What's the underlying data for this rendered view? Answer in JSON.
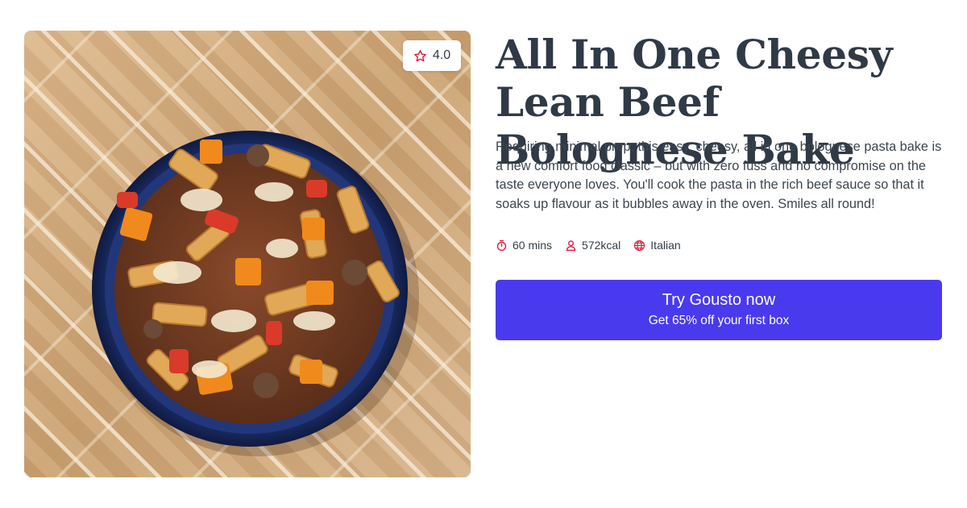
{
  "recipe": {
    "title": "All In One Cheesy Lean Beef Bolognese Bake",
    "description": "Requiring minimal prep, this easy, cheesy, all in one bolognese pasta bake is a new comfort food classic – but with zero fuss and no compromise on the taste everyone loves. You'll cook the pasta in the rich beef sauce so that it soaks up flavour as it bubbles away in the oven. Smiles all round!",
    "rating": "4.0",
    "image_icon": "pasta-bake-photo",
    "meta": [
      {
        "icon": "stopwatch-icon",
        "label": "60 mins"
      },
      {
        "icon": "person-icon",
        "label": "572kcal"
      },
      {
        "icon": "globe-icon",
        "label": "Italian"
      }
    ]
  },
  "cta": {
    "title": "Try Gousto now",
    "subtitle": "Get 65% off your first box"
  },
  "colors": {
    "accent": "#4a3aee",
    "icon_red": "#e0193a",
    "text": "#333d47"
  }
}
